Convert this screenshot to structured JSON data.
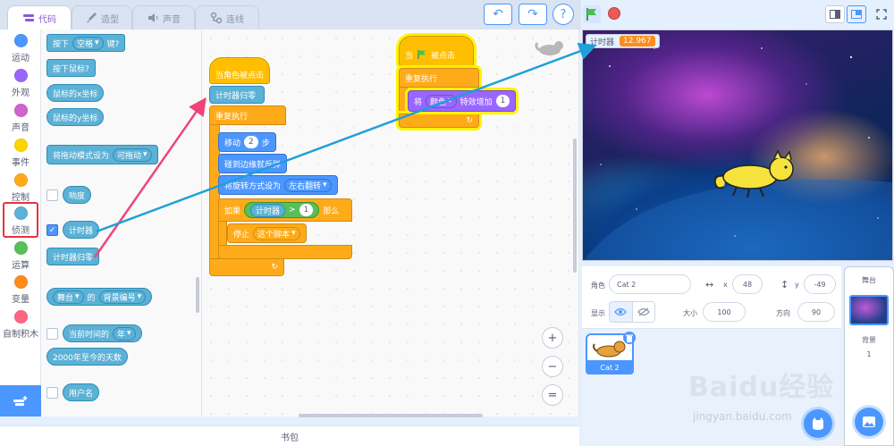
{
  "tabs": [
    {
      "label": "代码",
      "icon": "code-icon"
    },
    {
      "label": "造型",
      "icon": "brush-icon"
    },
    {
      "label": "声音",
      "icon": "speaker-icon"
    },
    {
      "label": "连线",
      "icon": "link-icon"
    }
  ],
  "toolbar": {
    "undo": "undo-icon",
    "redo": "redo-icon",
    "help": "?"
  },
  "categories": [
    {
      "label": "运动",
      "color": "#4c97ff"
    },
    {
      "label": "外观",
      "color": "#9966ff"
    },
    {
      "label": "声音",
      "color": "#cf63cf"
    },
    {
      "label": "事件",
      "color": "#ffd500"
    },
    {
      "label": "控制",
      "color": "#ffab19"
    },
    {
      "label": "侦测",
      "color": "#5cb1d6"
    },
    {
      "label": "运算",
      "color": "#59c059"
    },
    {
      "label": "变量",
      "color": "#ff8c1a"
    },
    {
      "label": "自制积木",
      "color": "#ff6680"
    }
  ],
  "palette": {
    "key_pressed": {
      "pre": "按下",
      "key": "空格",
      "post": "键?"
    },
    "mouse_down": "按下鼠标?",
    "mouse_x": "鼠标的x坐标",
    "mouse_y": "鼠标的y坐标",
    "drag_mode": {
      "text": "将拖动模式设为",
      "value": "可拖动"
    },
    "loudness": "响度",
    "timer": "计时器",
    "reset_timer": "计时器归零",
    "of_block": {
      "target": "舞台",
      "of": "的",
      "attr": "背景编号"
    },
    "current": {
      "text": "当前时间的",
      "value": "年"
    },
    "days_since": "2000年至今的天数",
    "username": "用户名"
  },
  "script1": {
    "hat": "当角色被点击",
    "reset": "计时器归零",
    "forever": "重复执行",
    "move": {
      "text": "移动",
      "value": "2",
      "unit": "步"
    },
    "bounce": "碰到边缘就反弹",
    "rotation": {
      "text": "将旋转方式设为",
      "value": "左右翻转"
    },
    "if": {
      "text": "如果",
      "then": "那么",
      "left": "计时器",
      "op": ">",
      "right": "1"
    },
    "stop": {
      "text": "停止",
      "value": "这个脚本"
    }
  },
  "script2": {
    "hat": {
      "pre": "当",
      "post": "被点击"
    },
    "forever": "重复执行",
    "effect": {
      "pre": "将",
      "value": "颜色",
      "mid": "特效增加",
      "num": "1"
    }
  },
  "zoom": {
    "in": "+",
    "out": "−",
    "reset": "="
  },
  "backpack": "书包",
  "monitor": {
    "label": "计时器",
    "value": "12.967"
  },
  "sprite": {
    "label_name": "角色",
    "name": "Cat 2",
    "label_x": "x",
    "x": "48",
    "label_y": "y",
    "y": "-49",
    "label_show": "显示",
    "label_size": "大小",
    "size": "100",
    "label_dir": "方向",
    "direction": "90",
    "tile_name": "Cat 2"
  },
  "stage_panel": {
    "title": "舞台",
    "backdrop_label": "背景",
    "backdrop_count": "1"
  },
  "watermark": {
    "main": "Baidu经验",
    "sub": "jingyan.baidu.com"
  }
}
